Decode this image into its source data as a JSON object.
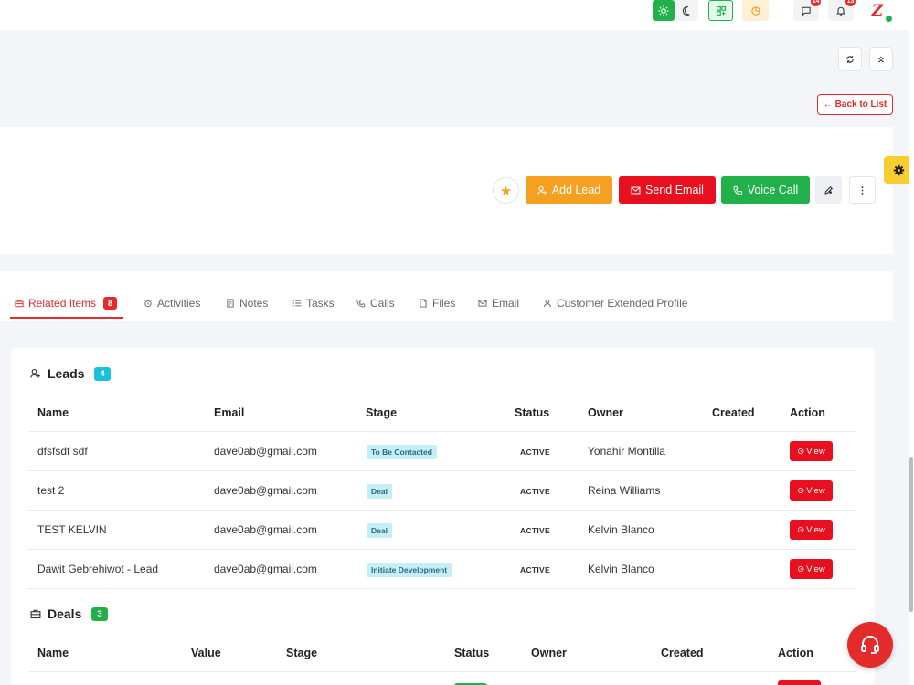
{
  "topbar": {
    "icons": [
      "sun-icon",
      "moon-icon",
      "apps-icon",
      "pie-icon",
      "chat-icon",
      "bell-icon",
      "logo-icon"
    ],
    "chat_badge": "14",
    "bell_badge": "13",
    "logo_text": "Z"
  },
  "header": {
    "refresh_icon": "refresh-icon",
    "collapse_icon": "chevrons-up-icon",
    "back_to_list": "Back to List"
  },
  "profile_actions": {
    "add_lead": "Add Lead",
    "send_email": "Send Email",
    "voice_call": "Voice Call"
  },
  "tabs": [
    {
      "label": "Related Items",
      "count": "8",
      "icon": "briefcase-icon",
      "active": true
    },
    {
      "label": "Activities",
      "icon": "alarm-icon"
    },
    {
      "label": "Notes",
      "icon": "note-icon"
    },
    {
      "label": "Tasks",
      "icon": "list-icon"
    },
    {
      "label": "Calls",
      "icon": "phone-icon"
    },
    {
      "label": "Files",
      "icon": "file-icon"
    },
    {
      "label": "Email",
      "icon": "mail-icon"
    },
    {
      "label": "Customer Extended Profile",
      "icon": "user-icon"
    }
  ],
  "leads": {
    "title": "Leads",
    "count": "4",
    "columns": [
      "Name",
      "Email",
      "Stage",
      "Status",
      "Owner",
      "Created",
      "Action"
    ],
    "rows": [
      {
        "name": "dfsfsdf sdf",
        "email": "dave0ab@gmail.com",
        "stage": "To Be Contacted",
        "status": "ACTIVE",
        "owner": "Yonahir Montilla",
        "created": "",
        "action": "View"
      },
      {
        "name": "test 2",
        "email": "dave0ab@gmail.com",
        "stage": "Deal",
        "status": "ACTIVE",
        "owner": "Reina Williams",
        "created": "",
        "action": "View"
      },
      {
        "name": "TEST KELVIN",
        "email": "dave0ab@gmail.com",
        "stage": "Deal",
        "status": "ACTIVE",
        "owner": "Kelvin Blanco",
        "created": "",
        "action": "View"
      },
      {
        "name": "Dawit Gebrehiwot - Lead",
        "email": "dave0ab@gmail.com",
        "stage": "Initiate Development",
        "status": "ACTIVE",
        "owner": "Kelvin Blanco",
        "created": "",
        "action": "View"
      }
    ]
  },
  "deals": {
    "title": "Deals",
    "count": "3",
    "columns": [
      "Name",
      "Value",
      "Stage",
      "Status",
      "Owner",
      "Created",
      "Action"
    ]
  },
  "colors": {
    "primary_red": "#e32b2b",
    "orange": "#f6a021",
    "green": "#22b04b",
    "cyan": "#17c1d9",
    "yellow": "#f8cd30"
  }
}
